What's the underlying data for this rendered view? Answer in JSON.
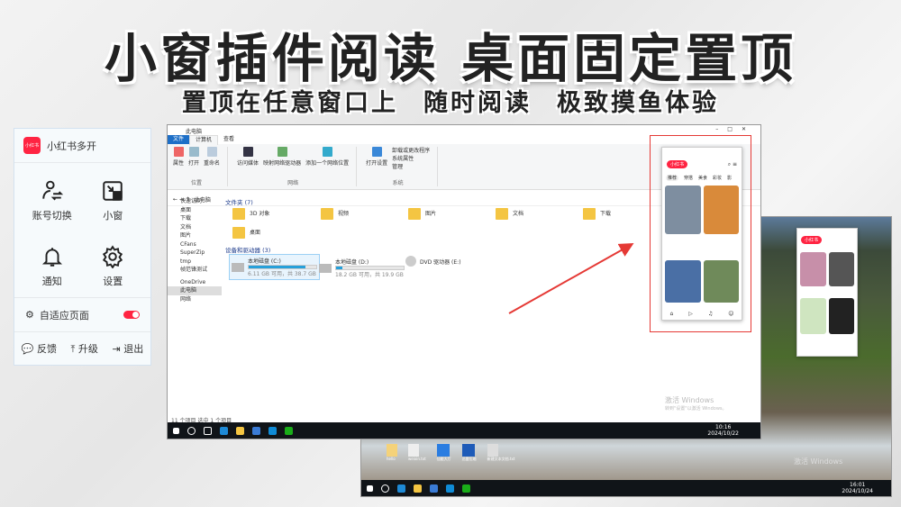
{
  "headline": "小窗插件阅读 桌面固定置顶",
  "subline": [
    "置顶在任意窗口上",
    "随时阅读",
    "极致摸鱼体验"
  ],
  "panel": {
    "app_name": "小红书多开",
    "logo_text": "小红书",
    "grid": [
      {
        "label": "账号切换",
        "icon": "user-switch-icon"
      },
      {
        "label": "小窗",
        "icon": "mini-window-icon"
      },
      {
        "label": "通知",
        "icon": "bell-icon"
      },
      {
        "label": "设置",
        "icon": "gear-icon"
      }
    ],
    "adaptive_label": "自适应页面",
    "adaptive_on": true,
    "footer": [
      "反馈",
      "升级",
      "退出"
    ]
  },
  "explorer": {
    "title": "此电脑",
    "tabs": [
      "文件",
      "计算机",
      "查看"
    ],
    "ribbon": [
      {
        "group": "位置",
        "items": [
          "属性",
          "打开",
          "重命名"
        ]
      },
      {
        "group": "网络",
        "items": [
          "访问媒体",
          "映射网络驱动器",
          "添加一个网络位置"
        ]
      },
      {
        "group": "系统",
        "items": [
          "打开设置",
          "卸载或更改程序",
          "系统属性",
          "管理"
        ]
      }
    ],
    "address": "此电脑",
    "nav": [
      "快速访问",
      "桌面",
      "下载",
      "文档",
      "图片",
      "CFans",
      "SuperZip",
      "tmp",
      "帧范锋测试",
      "OneDrive",
      "此电脑",
      "网络"
    ],
    "folders_header": "文件夹 (7)",
    "folders": [
      "3D 对象",
      "视频",
      "图片",
      "文档",
      "下载",
      "桌面"
    ],
    "drives_header": "设备和驱动器 (3)",
    "drives": [
      {
        "name": "本地磁盘 (C:)",
        "info": "6.11 GB 可用，共 38.7 GB",
        "used": 0.84
      },
      {
        "name": "本地磁盘 (D:)",
        "info": "18.2 GB 可用，共 19.9 GB",
        "used": 0.09
      },
      {
        "name": "DVD 驱动器 (E:)"
      }
    ],
    "status": "11 个项目   选中 1 个项目",
    "watermark": "激活 Windows",
    "watermark_sub": "转到\"设置\"以激活 Windows。",
    "clock_time": "10:16",
    "clock_date": "2024/10/22"
  },
  "phone": {
    "logo": "小红书",
    "tabs": [
      "推荐",
      "穿搭",
      "美食",
      "彩妆",
      "影"
    ]
  },
  "desktop2": {
    "icons": [
      "hello",
      "weixin.txt",
      "仙能大厅",
      "迅雷压缩",
      "新建文本文档.txt"
    ],
    "watermark": "激活 Windows",
    "clock_time": "16:01",
    "clock_date": "2024/10/24"
  },
  "colors": {
    "brand": "#ff2442",
    "highlight": "#e53935",
    "accent": "#1e6fc7"
  }
}
